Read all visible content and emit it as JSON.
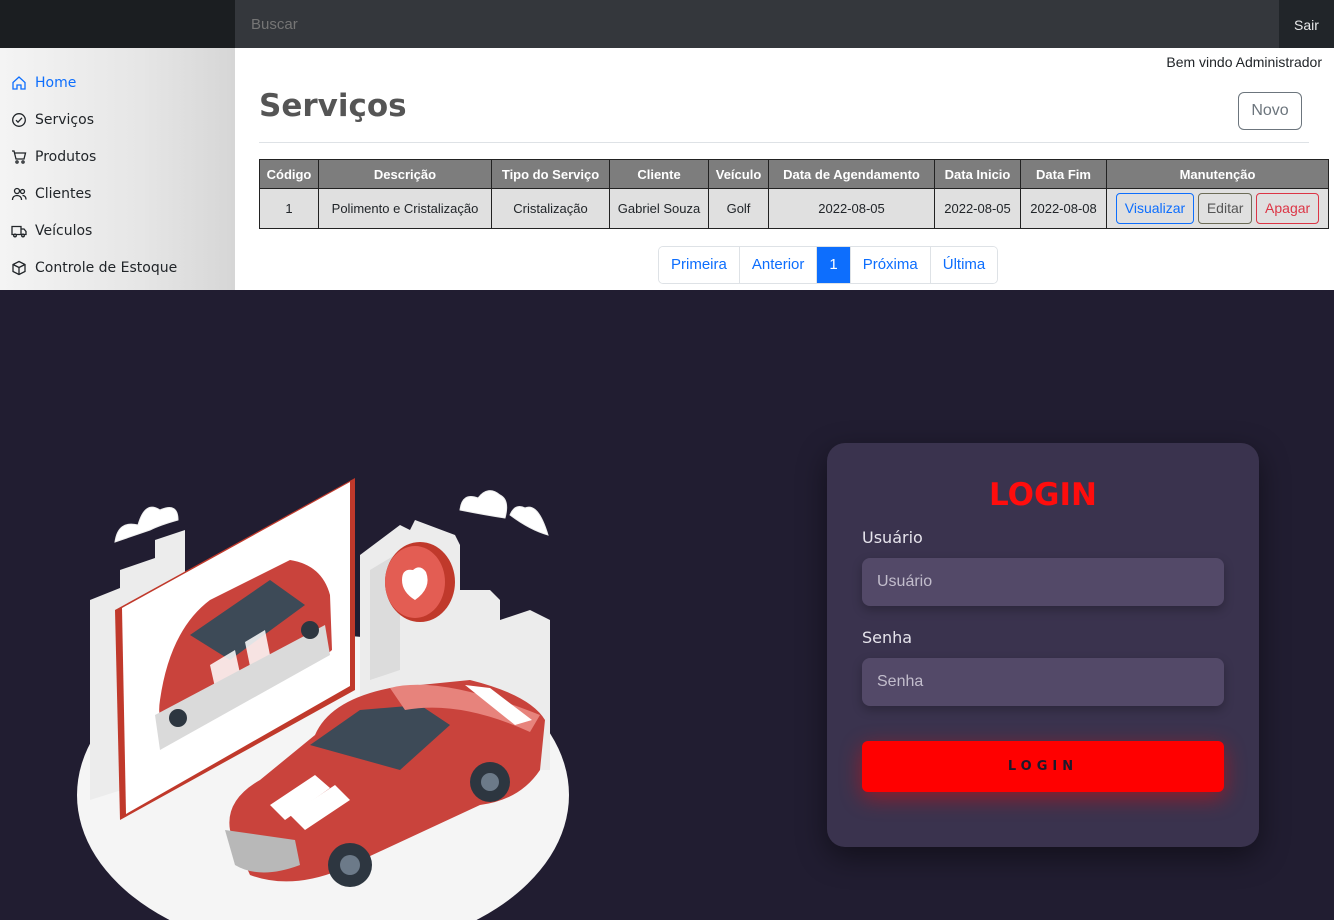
{
  "topbar": {
    "search_placeholder": "Buscar",
    "logout_label": "Sair"
  },
  "sidebar": {
    "items": [
      {
        "label": "Home",
        "icon": "home-icon",
        "active": true
      },
      {
        "label": "Serviços",
        "icon": "check-circle-icon"
      },
      {
        "label": "Produtos",
        "icon": "cart-icon"
      },
      {
        "label": "Clientes",
        "icon": "people-icon"
      },
      {
        "label": "Veículos",
        "icon": "truck-icon"
      },
      {
        "label": "Controle de Estoque",
        "icon": "box-icon"
      }
    ]
  },
  "main": {
    "welcome": "Bem vindo Administrador",
    "title": "Serviços",
    "new_button": "Novo",
    "table": {
      "headers": [
        "Código",
        "Descrição",
        "Tipo do Serviço",
        "Cliente",
        "Veículo",
        "Data de Agendamento",
        "Data Inicio",
        "Data Fim",
        "Manutenção"
      ],
      "rows": [
        {
          "codigo": "1",
          "descricao": "Polimento e Cristalização",
          "tipo": "Cristalização",
          "cliente": "Gabriel Souza",
          "veiculo": "Golf",
          "agendamento": "2022-08-05",
          "inicio": "2022-08-05",
          "fim": "2022-08-08"
        }
      ],
      "actions": {
        "view": "Visualizar",
        "edit": "Editar",
        "delete": "Apagar"
      }
    },
    "pagination": {
      "first": "Primeira",
      "prev": "Anterior",
      "current": "1",
      "next": "Próxima",
      "last": "Última"
    }
  },
  "login": {
    "title": "LOGIN",
    "user_label": "Usuário",
    "user_placeholder": "Usuário",
    "password_label": "Senha",
    "password_placeholder": "Senha",
    "button": "LOGIN"
  },
  "colors": {
    "accent_blue": "#0d6efd",
    "login_red": "#ff0000",
    "dark_bg": "#211d31",
    "card_bg": "#3a334e"
  }
}
